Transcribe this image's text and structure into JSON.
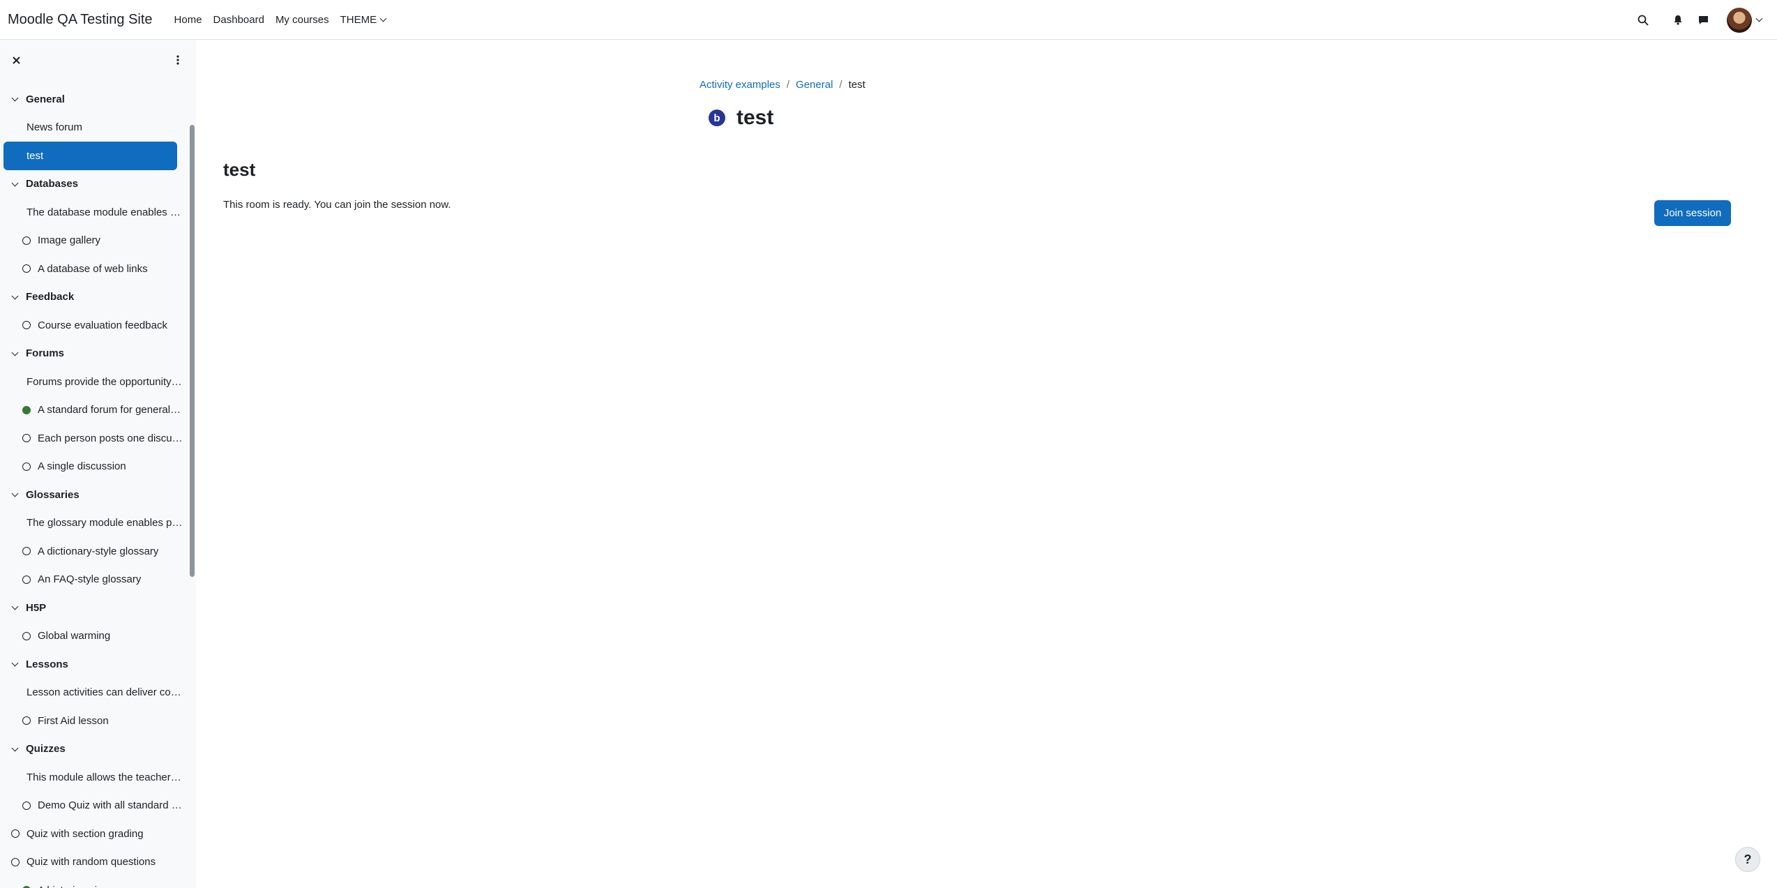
{
  "navbar": {
    "brand": "Moodle QA Testing Site",
    "links": [
      "Home",
      "Dashboard",
      "My courses"
    ],
    "theme_label": "THEME"
  },
  "breadcrumb": [
    "Activity examples",
    "General",
    "test"
  ],
  "page": {
    "title": "test",
    "icon_letter": "b",
    "activity_title": "test",
    "status": "This room is ready. You can join the session now.",
    "join_label": "Join session",
    "help_label": "?"
  },
  "course_index": [
    {
      "type": "section",
      "label": "General"
    },
    {
      "type": "label",
      "label": "News forum"
    },
    {
      "type": "active",
      "label": "test"
    },
    {
      "type": "section",
      "label": "Databases"
    },
    {
      "type": "label",
      "label": "The database module enables participants to create, maintain and search a bank of records"
    },
    {
      "type": "activity",
      "label": "Image gallery",
      "done": false
    },
    {
      "type": "activity",
      "label": "A database of web links",
      "done": false
    },
    {
      "type": "section",
      "label": "Feedback"
    },
    {
      "type": "activity",
      "label": "Course evaluation feedback",
      "done": false
    },
    {
      "type": "section",
      "label": "Forums"
    },
    {
      "type": "label",
      "label": "Forums provide the opportunity for discussion"
    },
    {
      "type": "activity",
      "label": "A standard forum for general use",
      "done": true
    },
    {
      "type": "activity",
      "label": "Each person posts one discussion",
      "done": false
    },
    {
      "type": "activity",
      "label": "A single discussion",
      "done": false
    },
    {
      "type": "section",
      "label": "Glossaries"
    },
    {
      "type": "label",
      "label": "The glossary module enables participants to create and maintain a list of definitions"
    },
    {
      "type": "activity",
      "label": "A dictionary-style glossary",
      "done": false
    },
    {
      "type": "activity",
      "label": "An FAQ-style glossary",
      "done": false
    },
    {
      "type": "section",
      "label": "H5P"
    },
    {
      "type": "activity",
      "label": "Global warming",
      "done": false
    },
    {
      "type": "section",
      "label": "Lessons"
    },
    {
      "type": "label",
      "label": "Lesson activities can deliver content in flexible ways"
    },
    {
      "type": "activity",
      "label": "First Aid lesson",
      "done": false
    },
    {
      "type": "section",
      "label": "Quizzes"
    },
    {
      "type": "label",
      "label": "This module allows the teacher to design and set quizzes"
    },
    {
      "type": "activity",
      "label": "Demo Quiz with all standard question types",
      "done": false
    },
    {
      "type": "top",
      "label": "Quiz with section grading",
      "done": false
    },
    {
      "type": "top",
      "label": "Quiz with random questions",
      "done": false
    },
    {
      "type": "activity",
      "label": "A historic quiz",
      "done": true
    }
  ]
}
